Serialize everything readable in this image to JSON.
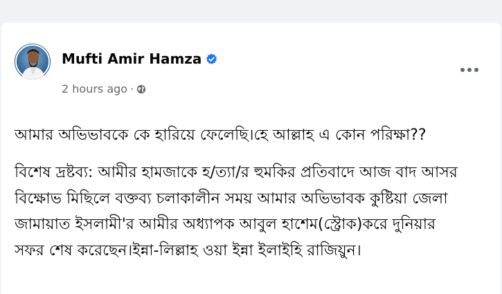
{
  "post": {
    "author_name": "Mufti Amir Hamza",
    "timestamp": "2 hours ago",
    "separator": "·",
    "privacy_icon": "globe-icon",
    "verified_icon": "verified-badge-icon",
    "more_icon": "more-options-icon",
    "line1": "আমার অভিভাবকে কে হারিয়ে ফেলেছি।হে আল্লাহ এ কোন পরিক্ষা??",
    "body": [
      "বিশেষ দ্রষ্টব্য: আমীর হামজাকে হ/ত্যা/র হুমকির প্রতিবাদে আজ বাদ আসর",
      "বিক্ষোভ মিছিলে বক্তব্য চলাকালীন সময় আমার অভিভাবক কুষ্টিয়া জেলা",
      "জামায়াত ইসলামী'র আমীর অধ্যাপক আবুল হাশেম(স্ট্রোক)করে দুনিয়ার",
      "সফর শেষ করেছেন।ইন্না-লিল্লাহ ওয়া ইন্না ইলাইহি রাজিয়ুন।"
    ]
  },
  "colors": {
    "page_bg": "#f0f2f5",
    "card_bg": "#ffffff",
    "verified_blue": "#1877f2",
    "meta_gray": "#65676b",
    "text": "#050505"
  }
}
